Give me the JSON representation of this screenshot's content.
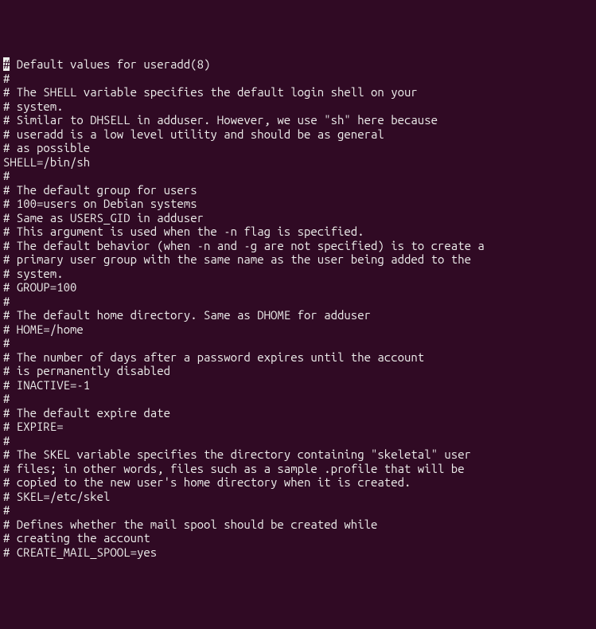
{
  "cursor_char": "#",
  "lines": [
    " Default values for useradd(8)",
    "#",
    "# The SHELL variable specifies the default login shell on your",
    "# system.",
    "# Similar to DHSELL in adduser. However, we use \"sh\" here because",
    "# useradd is a low level utility and should be as general",
    "# as possible",
    "SHELL=/bin/sh",
    "#",
    "# The default group for users",
    "# 100=users on Debian systems",
    "# Same as USERS_GID in adduser",
    "# This argument is used when the -n flag is specified.",
    "# The default behavior (when -n and -g are not specified) is to create a",
    "# primary user group with the same name as the user being added to the",
    "# system.",
    "# GROUP=100",
    "#",
    "# The default home directory. Same as DHOME for adduser",
    "# HOME=/home",
    "#",
    "# The number of days after a password expires until the account",
    "# is permanently disabled",
    "# INACTIVE=-1",
    "#",
    "# The default expire date",
    "# EXPIRE=",
    "#",
    "# The SKEL variable specifies the directory containing \"skeletal\" user",
    "# files; in other words, files such as a sample .profile that will be",
    "# copied to the new user's home directory when it is created.",
    "# SKEL=/etc/skel",
    "#",
    "# Defines whether the mail spool should be created while",
    "# creating the account",
    "# CREATE_MAIL_SPOOL=yes"
  ]
}
